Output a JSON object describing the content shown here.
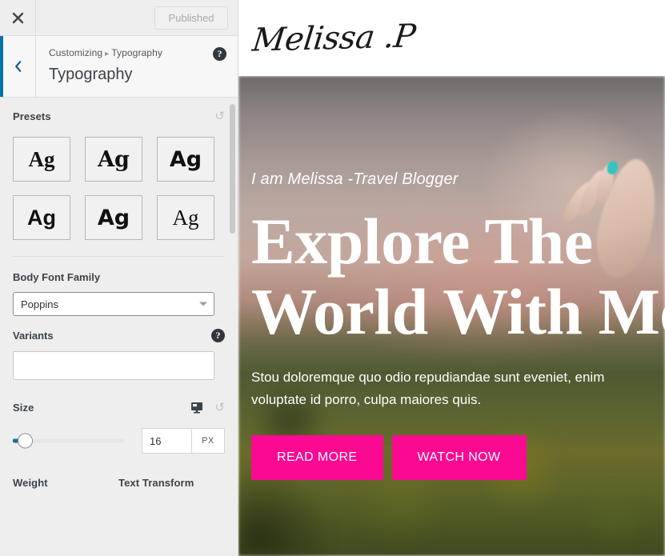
{
  "customizer": {
    "topbar": {
      "close_icon": "close-icon",
      "publish_label": "Published"
    },
    "header": {
      "back_icon": "chevron-left-icon",
      "breadcrumb_root": "Customizing",
      "breadcrumb_separator": "▸",
      "breadcrumb_current": "Typography",
      "title": "Typography",
      "help_icon": "help-icon",
      "help_glyph": "?"
    },
    "presets": {
      "label": "Presets",
      "reset_icon": "reset-icon",
      "reset_glyph": "↺",
      "items": [
        {
          "sample": "Ag"
        },
        {
          "sample": "Ag"
        },
        {
          "sample": "Ag"
        },
        {
          "sample": "Ag"
        },
        {
          "sample": "Ag"
        },
        {
          "sample": "Ag"
        }
      ]
    },
    "body_font_family": {
      "label": "Body Font Family",
      "value": "Poppins",
      "caret_icon": "chevron-down-icon"
    },
    "variants": {
      "label": "Variants",
      "help_icon": "help-icon",
      "help_glyph": "?",
      "value": "",
      "placeholder": ""
    },
    "size": {
      "label": "Size",
      "device_icon": "desktop-monitor-icon",
      "reset_icon": "reset-icon",
      "reset_glyph": "↺",
      "value": "16",
      "unit": "PX",
      "slider_percent": 3
    },
    "weight": {
      "label": "Weight"
    },
    "text_transform": {
      "label": "Text Transform"
    }
  },
  "preview": {
    "logo": "Melissa .P",
    "hero": {
      "subtitle": "I am Melissa -Travel Blogger",
      "title_line1": "Explore The",
      "title_line2": "World With Me",
      "paragraph": "Stou doloremque quo odio repudiandae sunt eveniet, enim voluptate id porro, culpa maiores quis.",
      "primary_button": "READ MORE",
      "secondary_button": "WATCH NOW",
      "accent_color": "#FB0A91"
    }
  }
}
